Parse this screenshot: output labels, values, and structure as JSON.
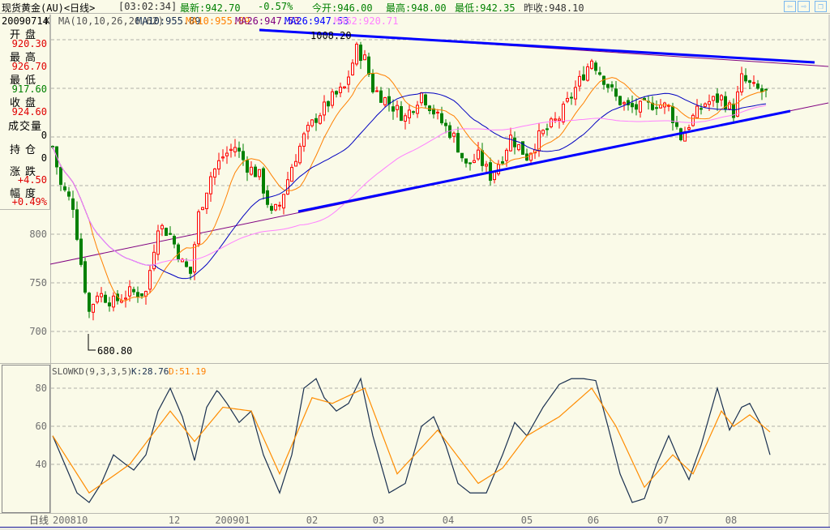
{
  "header": {
    "title": "现货黄金(AU)<日线>",
    "time": "[03:02:34]",
    "latest": "最新:942.70",
    "change": "-0.57%",
    "open": "今开:946.00",
    "high": "最高:948.00",
    "low": "最低:942.35",
    "prev_close": "昨收:948.10"
  },
  "legend": {
    "date": "20090714",
    "k": "K",
    "ma_params": "MA(10,10,26,26,62)",
    "ma10a": "MA10:955.89",
    "ma10b": "MA10:955.89",
    "ma26a": "MA26:947.53",
    "ma26b": "MA26:947.53",
    "ma62": "MA62:920.71"
  },
  "info": {
    "open_label": "开盘",
    "open_value": "920.30",
    "high_label": "最高",
    "high_value": "926.70",
    "low_label": "最低",
    "low_value": "917.60",
    "close_label": "收盘",
    "close_value": "924.60",
    "volume_label": "成交量",
    "volume_value": "0",
    "oi_label": "持仓",
    "oi_value": "0",
    "change_label": "涨跌",
    "change_value": "+4.50",
    "pct_label": "幅度",
    "pct_value": "+0.49%"
  },
  "annotations": {
    "high_mark": "1008.20",
    "low_mark": "680.80"
  },
  "kd": {
    "title": "SLOWKD(9,3,3,5)",
    "k": "K:28.76",
    "d": "D:51.19"
  },
  "period_label": "日线",
  "colors": {
    "up": "#ff0000",
    "down": "#008000",
    "ma10": "#ff8000",
    "ma26": "#0000c0",
    "ma62": "#ff80ff",
    "trend": "#0000ff",
    "trend_thin": "#800080",
    "k": "#1a3050",
    "d": "#ff8c00"
  },
  "chart_data": [
    {
      "type": "candlestick",
      "title": "现货黄金(AU) 日线",
      "ylim": [
        660,
        1030
      ],
      "yticks": [
        700,
        750,
        800
      ],
      "close_anchors": [
        [
          0,
          890
        ],
        [
          2,
          850
        ],
        [
          5,
          830
        ],
        [
          7,
          770
        ],
        [
          9,
          720
        ],
        [
          11,
          740
        ],
        [
          15,
          730
        ],
        [
          19,
          740
        ],
        [
          23,
          740
        ],
        [
          26,
          810
        ],
        [
          29,
          800
        ],
        [
          32,
          770
        ],
        [
          34,
          760
        ],
        [
          36,
          820
        ],
        [
          39,
          860
        ],
        [
          42,
          880
        ],
        [
          45,
          890
        ],
        [
          48,
          870
        ],
        [
          51,
          860
        ],
        [
          54,
          820
        ],
        [
          56,
          830
        ],
        [
          59,
          870
        ],
        [
          62,
          900
        ],
        [
          65,
          920
        ],
        [
          69,
          940
        ],
        [
          72,
          950
        ],
        [
          75,
          990
        ],
        [
          77,
          980
        ],
        [
          79,
          950
        ],
        [
          83,
          935
        ],
        [
          87,
          920
        ],
        [
          91,
          945
        ],
        [
          95,
          920
        ],
        [
          99,
          900
        ],
        [
          102,
          870
        ],
        [
          105,
          880
        ],
        [
          108,
          860
        ],
        [
          111,
          880
        ],
        [
          113,
          900
        ],
        [
          117,
          880
        ],
        [
          120,
          900
        ],
        [
          125,
          920
        ],
        [
          129,
          950
        ],
        [
          133,
          980
        ],
        [
          136,
          960
        ],
        [
          139,
          940
        ],
        [
          142,
          930
        ],
        [
          145,
          930
        ],
        [
          149,
          935
        ],
        [
          152,
          930
        ],
        [
          155,
          900
        ],
        [
          158,
          920
        ],
        [
          161,
          935
        ],
        [
          165,
          940
        ],
        [
          168,
          925
        ],
        [
          170,
          960
        ],
        [
          173,
          950
        ],
        [
          176,
          945
        ]
      ],
      "ma_periods": [
        10,
        26,
        62
      ],
      "xticks": [
        [
          0,
          "200810"
        ],
        [
          30,
          "12"
        ],
        [
          44.4,
          "200901"
        ],
        [
          64,
          "02"
        ],
        [
          80.4,
          "03"
        ],
        [
          97.6,
          "04"
        ],
        [
          117,
          "05"
        ],
        [
          133.4,
          "06"
        ],
        [
          150.6,
          "07"
        ],
        [
          167.4,
          "08"
        ]
      ]
    },
    {
      "type": "line",
      "title": "SLOWKD(9,3,3,5)",
      "ylim": [
        12,
        92
      ],
      "yticks": [
        40,
        60,
        80
      ],
      "series": [
        {
          "name": "K",
          "values": [
            [
              0,
              55
            ],
            [
              3,
              40
            ],
            [
              6,
              25
            ],
            [
              9,
              20
            ],
            [
              12,
              30
            ],
            [
              15,
              45
            ],
            [
              18,
              40
            ],
            [
              20,
              37
            ],
            [
              23,
              45
            ],
            [
              26,
              68
            ],
            [
              29,
              80
            ],
            [
              32,
              65
            ],
            [
              35,
              42
            ],
            [
              38,
              70
            ],
            [
              40.6,
              79
            ],
            [
              43,
              72
            ],
            [
              46,
              62
            ],
            [
              49,
              68
            ],
            [
              52,
              45
            ],
            [
              56,
              25
            ],
            [
              59,
              45
            ],
            [
              62,
              80
            ],
            [
              65,
              85
            ],
            [
              67,
              75
            ],
            [
              70,
              68
            ],
            [
              73,
              72
            ],
            [
              76,
              85
            ],
            [
              79,
              55
            ],
            [
              83,
              25
            ],
            [
              87,
              30
            ],
            [
              91,
              60
            ],
            [
              94,
              65
            ],
            [
              97,
              50
            ],
            [
              100,
              30
            ],
            [
              103,
              25
            ],
            [
              107,
              25
            ],
            [
              111,
              45
            ],
            [
              114,
              62
            ],
            [
              117,
              55
            ],
            [
              121,
              70
            ],
            [
              125,
              82
            ],
            [
              128,
              85
            ],
            [
              131,
              85
            ],
            [
              134,
              84
            ],
            [
              137,
              60
            ],
            [
              140,
              35
            ],
            [
              143,
              20
            ],
            [
              146,
              22
            ],
            [
              149,
              40
            ],
            [
              152,
              55
            ],
            [
              154,
              45
            ],
            [
              157,
              32
            ],
            [
              160,
              50
            ],
            [
              164,
              80
            ],
            [
              167,
              58
            ],
            [
              170,
              70
            ],
            [
              172,
              72
            ],
            [
              175,
              60
            ],
            [
              177,
              45
            ]
          ]
        },
        {
          "name": "D",
          "values": [
            [
              0,
              55
            ],
            [
              9,
              25
            ],
            [
              19,
              40
            ],
            [
              29,
              68
            ],
            [
              35,
              52
            ],
            [
              42,
              70
            ],
            [
              49,
              68
            ],
            [
              56,
              35
            ],
            [
              64,
              75
            ],
            [
              69,
              72
            ],
            [
              77,
              80
            ],
            [
              85,
              35
            ],
            [
              95,
              58
            ],
            [
              105,
              30
            ],
            [
              111,
              38
            ],
            [
              117,
              55
            ],
            [
              125,
              65
            ],
            [
              133,
              80
            ],
            [
              139,
              60
            ],
            [
              146,
              28
            ],
            [
              153,
              45
            ],
            [
              158,
              35
            ],
            [
              165,
              68
            ],
            [
              168,
              60
            ],
            [
              172,
              66
            ],
            [
              177,
              57
            ]
          ]
        }
      ]
    }
  ]
}
